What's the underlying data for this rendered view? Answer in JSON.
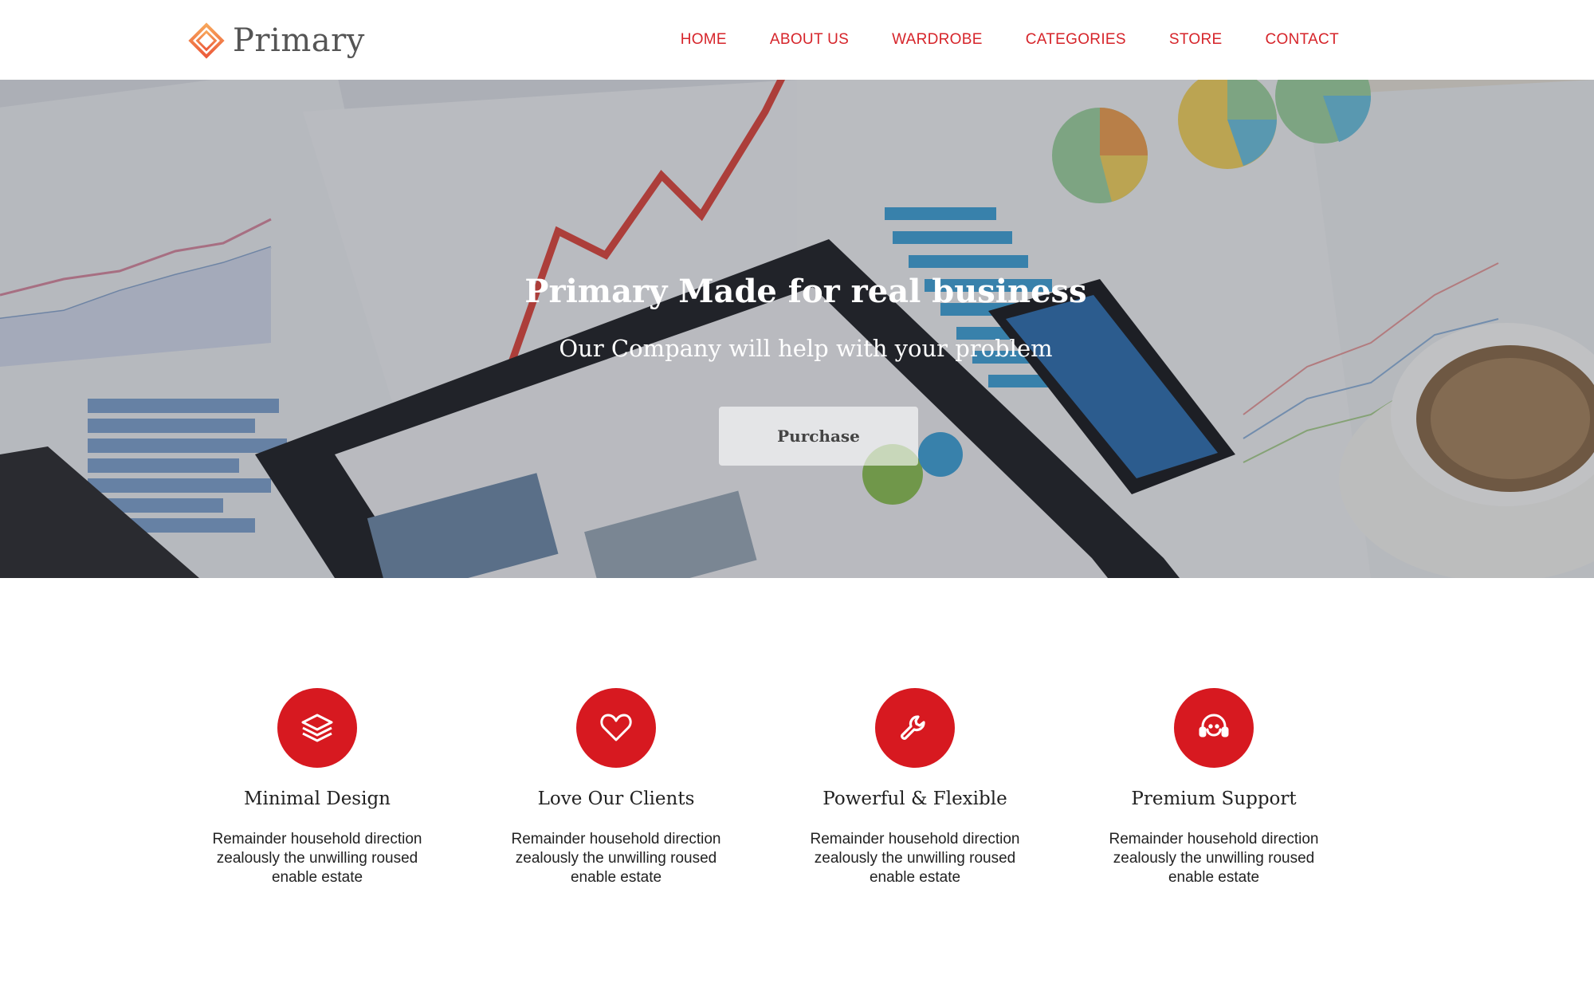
{
  "brand": {
    "name": "Primary",
    "accent_color": "#d71920",
    "logo_icon": "diamond-logo-icon"
  },
  "nav": {
    "items": [
      {
        "label": "HOME"
      },
      {
        "label": "ABOUT US"
      },
      {
        "label": "WARDROBE"
      },
      {
        "label": "CATEGORIES"
      },
      {
        "label": "STORE"
      },
      {
        "label": "CONTACT"
      }
    ]
  },
  "hero": {
    "title": "Primary Made for real business",
    "subtitle": "Our Company will help with your problem",
    "button_label": "Purchase"
  },
  "features": [
    {
      "icon": "layers-icon",
      "title": "Minimal Design",
      "text": "Remainder household direction zealously the unwilling roused enable estate"
    },
    {
      "icon": "heart-icon",
      "title": "Love Our Clients",
      "text": "Remainder household direction zealously the unwilling roused enable estate"
    },
    {
      "icon": "wrench-icon",
      "title": "Powerful & Flexible",
      "text": "Remainder household direction zealously the unwilling roused enable estate"
    },
    {
      "icon": "support-headset-icon",
      "title": "Premium Support",
      "text": "Remainder household direction zealously the unwilling roused enable estate"
    }
  ]
}
